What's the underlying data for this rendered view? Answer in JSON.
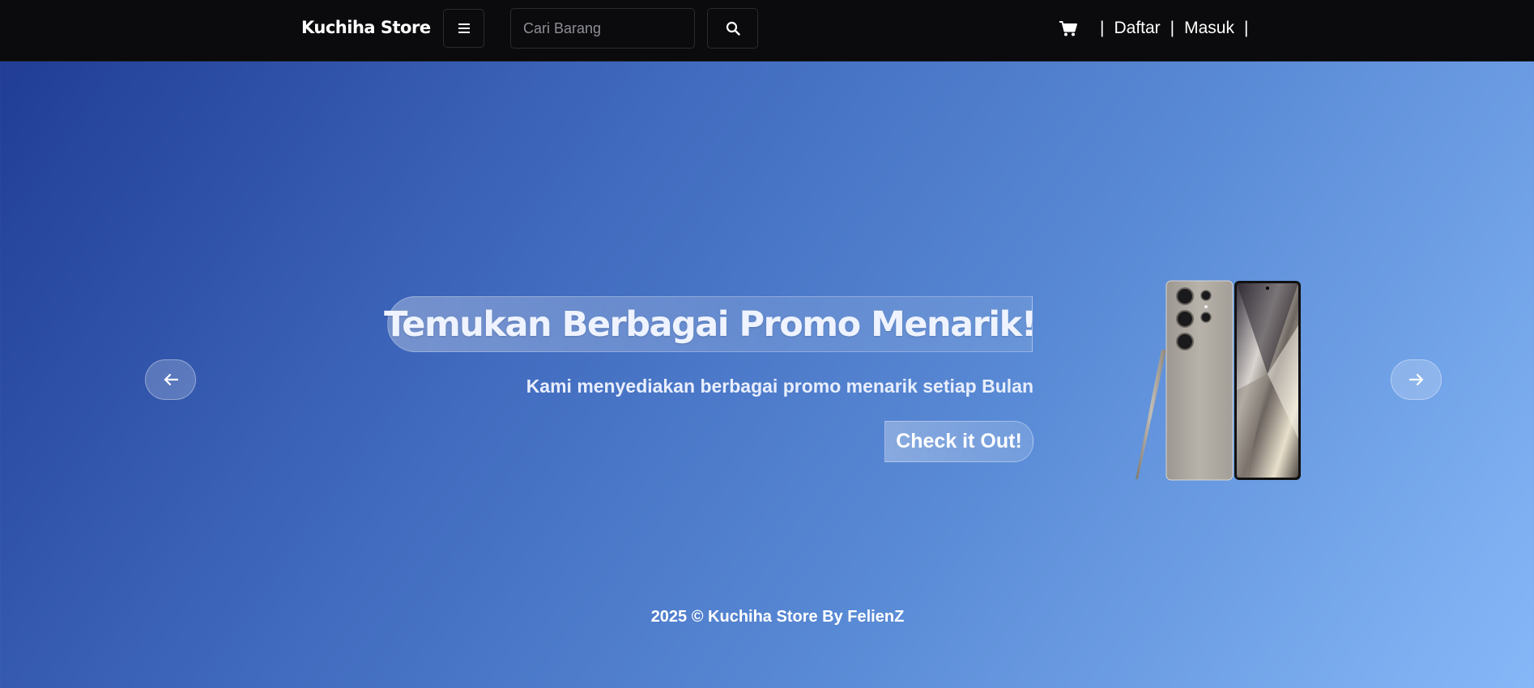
{
  "navbar": {
    "brand": "Kuchiha Store",
    "menu_icon": "hamburger-menu-icon",
    "search": {
      "placeholder": "Cari Barang",
      "value": "",
      "icon": "search-icon"
    },
    "cart_icon": "shopping-cart-icon",
    "auth": {
      "separator": "|",
      "register_label": "Daftar",
      "login_label": "Masuk"
    }
  },
  "hero": {
    "title": "Temukan Berbagai Promo Menarik!",
    "subtitle": "Kami menyediakan berbagai promo menarik setiap Bulan",
    "cta_label": "Check it Out!",
    "prev_icon": "arrow-left-icon",
    "next_icon": "arrow-right-icon",
    "product_image": "smartphone-with-stylus-product-image"
  },
  "footer": {
    "text": "2025 © Kuchiha Store By FelienZ"
  },
  "colors": {
    "navbar_bg": "#0b0b0d",
    "gradient_start": "#1f3a93",
    "gradient_end": "#86b8f8"
  }
}
